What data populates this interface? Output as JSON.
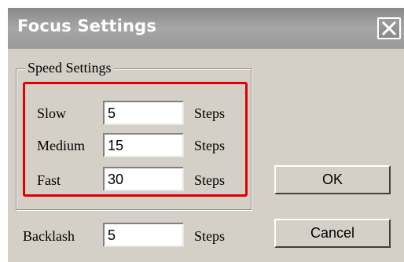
{
  "window": {
    "title": "Focus Settings"
  },
  "speed_settings": {
    "group_label": "Speed Settings",
    "rows": [
      {
        "label": "Slow",
        "value": "5",
        "unit": "Steps"
      },
      {
        "label": "Medium",
        "value": "15",
        "unit": "Steps"
      },
      {
        "label": "Fast",
        "value": "30",
        "unit": "Steps"
      }
    ]
  },
  "backlash": {
    "label": "Backlash",
    "value": "5",
    "unit": "Steps"
  },
  "buttons": {
    "ok": "OK",
    "cancel": "Cancel"
  },
  "colors": {
    "highlight": "#e00000",
    "titlebar": "#9a9a9a",
    "dialog_bg": "#d4d0c8"
  },
  "icons": {
    "close": "close-icon"
  }
}
